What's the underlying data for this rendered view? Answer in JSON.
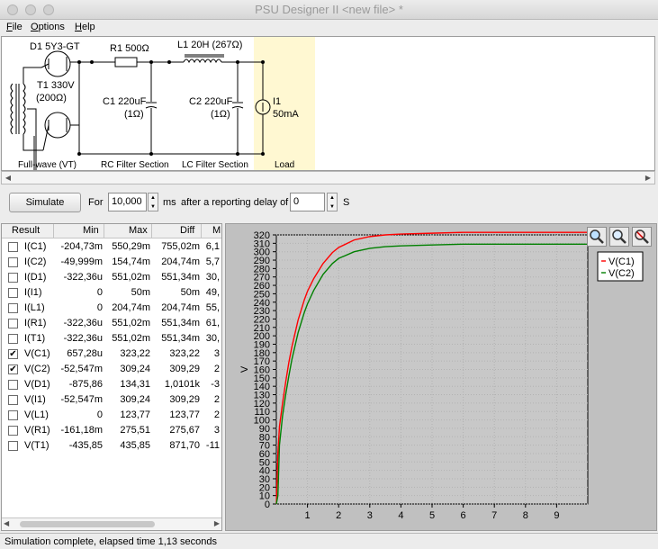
{
  "window": {
    "title": "PSU Designer II  <new file> *"
  },
  "menu": {
    "items": [
      {
        "pre": "",
        "u": "F",
        "post": "ile"
      },
      {
        "pre": "",
        "u": "O",
        "post": "ptions"
      },
      {
        "pre": "",
        "u": "H",
        "post": "elp"
      }
    ]
  },
  "schematic": {
    "rectifier": "D1 5Y3-GT",
    "transformer": "T1 330V",
    "transformer_r": "(200Ω)",
    "r1": "R1 500Ω",
    "l1": "L1 20H (267Ω)",
    "c1": "C1 220uF",
    "c1_r": "(1Ω)",
    "c2": "C2 220uF",
    "c2_r": "(1Ω)",
    "load": "I1",
    "load_val": "50mA",
    "sections": [
      "Full-wave (VT)",
      "RC Filter Section",
      "LC Filter Section",
      "Load"
    ]
  },
  "controls": {
    "simulate": "Simulate",
    "for_label": "For",
    "duration": "10,000",
    "ms_label": "ms",
    "delay_label": "after a reporting delay of",
    "delay": "0",
    "s_label": "S"
  },
  "results": {
    "columns": [
      "Result",
      "Min",
      "Max",
      "Diff",
      "M"
    ],
    "rows": [
      {
        "name": "I(C1)",
        "checked": false,
        "min": "-204,73m",
        "max": "550,29m",
        "diff": "755,02m",
        "m": "6,1"
      },
      {
        "name": "I(C2)",
        "checked": false,
        "min": "-49,999m",
        "max": "154,74m",
        "diff": "204,74m",
        "m": "5,7"
      },
      {
        "name": "I(D1)",
        "checked": false,
        "min": "-322,36u",
        "max": "551,02m",
        "diff": "551,34m",
        "m": "30,"
      },
      {
        "name": "I(I1)",
        "checked": false,
        "min": "0",
        "max": "50m",
        "diff": "50m",
        "m": "49,"
      },
      {
        "name": "I(L1)",
        "checked": false,
        "min": "0",
        "max": "204,74m",
        "diff": "204,74m",
        "m": "55,"
      },
      {
        "name": "I(R1)",
        "checked": false,
        "min": "-322,36u",
        "max": "551,02m",
        "diff": "551,34m",
        "m": "61,"
      },
      {
        "name": "I(T1)",
        "checked": false,
        "min": "-322,36u",
        "max": "551,02m",
        "diff": "551,34m",
        "m": "30,"
      },
      {
        "name": "V(C1)",
        "checked": true,
        "min": "657,28u",
        "max": "323,22",
        "diff": "323,22",
        "m": "3"
      },
      {
        "name": "V(C2)",
        "checked": true,
        "min": "-52,547m",
        "max": "309,24",
        "diff": "309,29",
        "m": "2"
      },
      {
        "name": "V(D1)",
        "checked": false,
        "min": "-875,86",
        "max": "134,31",
        "diff": "1,0101k",
        "m": "-3"
      },
      {
        "name": "V(I1)",
        "checked": false,
        "min": "-52,547m",
        "max": "309,24",
        "diff": "309,29",
        "m": "2"
      },
      {
        "name": "V(L1)",
        "checked": false,
        "min": "0",
        "max": "123,77",
        "diff": "123,77",
        "m": "2"
      },
      {
        "name": "V(R1)",
        "checked": false,
        "min": "-161,18m",
        "max": "275,51",
        "diff": "275,67",
        "m": "3"
      },
      {
        "name": "V(T1)",
        "checked": false,
        "min": "-435,85",
        "max": "435,85",
        "diff": "871,70",
        "m": "-11"
      }
    ]
  },
  "zoom": {
    "icons": [
      "zoom-in-icon",
      "zoom-fit-icon",
      "zoom-reset-icon"
    ]
  },
  "chart_data": {
    "type": "line",
    "ylabel": "V",
    "xlabel": "",
    "ylim": [
      0,
      320
    ],
    "xlim": [
      0,
      10
    ],
    "yticks": [
      0,
      10,
      20,
      30,
      40,
      50,
      60,
      70,
      80,
      90,
      100,
      110,
      120,
      130,
      140,
      150,
      160,
      170,
      180,
      190,
      200,
      210,
      220,
      230,
      240,
      250,
      260,
      270,
      280,
      290,
      300,
      310,
      320
    ],
    "xticks": [
      1,
      2,
      3,
      4,
      5,
      6,
      7,
      8,
      9
    ],
    "grid": true,
    "legend": "top-right",
    "series": [
      {
        "name": "V(C1)",
        "color": "#ff0000",
        "x": [
          0,
          0.05,
          0.1,
          0.2,
          0.3,
          0.4,
          0.5,
          0.7,
          0.9,
          1.0,
          1.2,
          1.5,
          1.8,
          2.0,
          2.5,
          3.0,
          3.5,
          4.0,
          5.0,
          6.0,
          7.0,
          8.0,
          9.0,
          10.0
        ],
        "values": [
          0,
          60,
          92,
          120,
          145,
          168,
          187,
          219,
          243,
          253,
          268,
          286,
          299,
          305,
          314,
          318,
          320,
          321,
          322,
          323,
          323,
          323,
          323,
          323
        ]
      },
      {
        "name": "V(C2)",
        "color": "#008000",
        "x": [
          0,
          0.05,
          0.1,
          0.2,
          0.3,
          0.4,
          0.5,
          0.7,
          0.9,
          1.0,
          1.2,
          1.5,
          1.8,
          2.0,
          2.5,
          3.0,
          3.5,
          4.0,
          5.0,
          6.0,
          7.0,
          8.0,
          9.0,
          10.0
        ],
        "values": [
          0,
          10,
          70,
          105,
          130,
          152,
          172,
          204,
          228,
          238,
          254,
          273,
          286,
          292,
          300,
          304,
          306,
          307,
          308,
          309,
          309,
          309,
          309,
          309
        ]
      }
    ]
  }
}
